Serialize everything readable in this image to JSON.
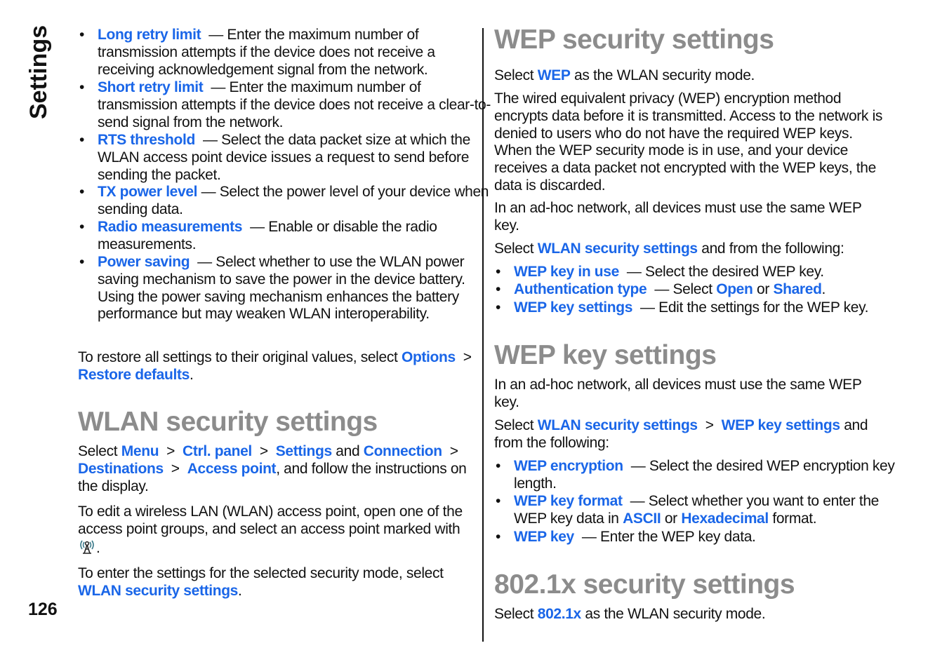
{
  "side_label": "Settings",
  "page_number": "126",
  "colors": {
    "link": "#1a66e8",
    "heading": "#8c8c8c"
  },
  "left": {
    "bullets": [
      [
        {
          "t": "Long retry limit",
          "link": true
        },
        {
          "t": "  — Enter the maximum number of transmission attempts if the device does not receive a receiving acknowledgement signal from the network."
        }
      ],
      [
        {
          "t": "Short retry limit",
          "link": true
        },
        {
          "t": "  — Enter the maximum number of transmission attempts if the device does not receive a clear-to-send signal from the network."
        }
      ],
      [
        {
          "t": "RTS threshold",
          "link": true
        },
        {
          "t": "  — Select the data packet size at which the WLAN access point device issues a request to send before sending the packet."
        }
      ],
      [
        {
          "t": "TX power level",
          "link": true
        },
        {
          "t": " — Select the power level of your device when sending data."
        }
      ],
      [
        {
          "t": "Radio measurements",
          "link": true
        },
        {
          "t": "  — Enable or disable the radio measurements."
        }
      ],
      [
        {
          "t": "Power saving",
          "link": true
        },
        {
          "t": "  — Select whether to use the WLAN power saving mechanism to save the power in the device battery. Using the power saving mechanism enhances the battery performance but may weaken WLAN interoperability."
        }
      ]
    ],
    "restore": [
      {
        "t": "To restore all settings to their original values, select "
      },
      {
        "t": "Options",
        "link": true
      },
      {
        "t": "  >  "
      },
      {
        "t": "Restore defaults",
        "link": true
      },
      {
        "t": "."
      }
    ],
    "wlan_heading": "WLAN security settings",
    "wlan_p1": [
      {
        "t": "Select "
      },
      {
        "t": "Menu",
        "link": true
      },
      {
        "t": "  >  "
      },
      {
        "t": "Ctrl. panel",
        "link": true
      },
      {
        "t": "  >  "
      },
      {
        "t": "Settings",
        "link": true
      },
      {
        "t": " and "
      },
      {
        "t": "Connection",
        "link": true
      },
      {
        "t": "  >  "
      },
      {
        "t": "Destinations",
        "link": true
      },
      {
        "t": "  >  "
      },
      {
        "t": "Access point",
        "link": true
      },
      {
        "t": ", and follow the instructions on the display."
      }
    ],
    "wlan_p2": [
      {
        "t": "To edit a wireless LAN (WLAN) access point, open one of the access point groups, and select an access point marked with "
      },
      {
        "icon": "wlan-antenna-icon"
      },
      {
        "t": "."
      }
    ],
    "wlan_p3": [
      {
        "t": "To enter the settings for the selected security mode, select "
      },
      {
        "t": "WLAN security settings",
        "link": true
      },
      {
        "t": "."
      }
    ]
  },
  "right": {
    "wep_heading": "WEP security settings",
    "wep_p1": [
      {
        "t": "Select "
      },
      {
        "t": "WEP",
        "link": true
      },
      {
        "t": " as the WLAN security mode."
      }
    ],
    "wep_p2": [
      {
        "t": "The wired equivalent privacy (WEP) encryption method encrypts data before it is transmitted. Access to the network is denied to users who do not have the required WEP keys. When the WEP security mode is in use, and your device receives a data packet not encrypted with the WEP keys, the data is discarded."
      }
    ],
    "wep_p3": [
      {
        "t": "In an ad-hoc network, all devices must use the same WEP key."
      }
    ],
    "wep_p4": [
      {
        "t": "Select "
      },
      {
        "t": "WLAN security settings",
        "link": true
      },
      {
        "t": " and from the following:"
      }
    ],
    "wep_bullets": [
      [
        {
          "t": "WEP key in use",
          "link": true
        },
        {
          "t": "  — Select the desired WEP key."
        }
      ],
      [
        {
          "t": "Authentication type",
          "link": true
        },
        {
          "t": "  — Select "
        },
        {
          "t": "Open",
          "link": true
        },
        {
          "t": " or "
        },
        {
          "t": "Shared",
          "link": true
        },
        {
          "t": "."
        }
      ],
      [
        {
          "t": "WEP key settings",
          "link": true
        },
        {
          "t": "  — Edit the settings for the WEP key."
        }
      ]
    ],
    "key_heading": "WEP key settings",
    "key_p1": [
      {
        "t": "In an ad-hoc network, all devices must use the same WEP key."
      }
    ],
    "key_p2": [
      {
        "t": "Select "
      },
      {
        "t": "WLAN security settings",
        "link": true
      },
      {
        "t": "  >  "
      },
      {
        "t": "WEP key settings",
        "link": true
      },
      {
        "t": " and from the following:"
      }
    ],
    "key_bullets": [
      [
        {
          "t": "WEP encryption",
          "link": true
        },
        {
          "t": "  — Select the desired WEP encryption key length."
        }
      ],
      [
        {
          "t": "WEP key format",
          "link": true
        },
        {
          "t": "  — Select whether you want to enter the WEP key data in "
        },
        {
          "t": "ASCII",
          "link": true
        },
        {
          "t": " or "
        },
        {
          "t": "Hexadecimal",
          "link": true
        },
        {
          "t": " format."
        }
      ],
      [
        {
          "t": "WEP key",
          "link": true
        },
        {
          "t": "  — Enter the WEP key data."
        }
      ]
    ],
    "x_heading": "802.1x security settings",
    "x_p1": [
      {
        "t": "Select "
      },
      {
        "t": "802.1x",
        "link": true
      },
      {
        "t": " as the WLAN security mode."
      }
    ]
  }
}
